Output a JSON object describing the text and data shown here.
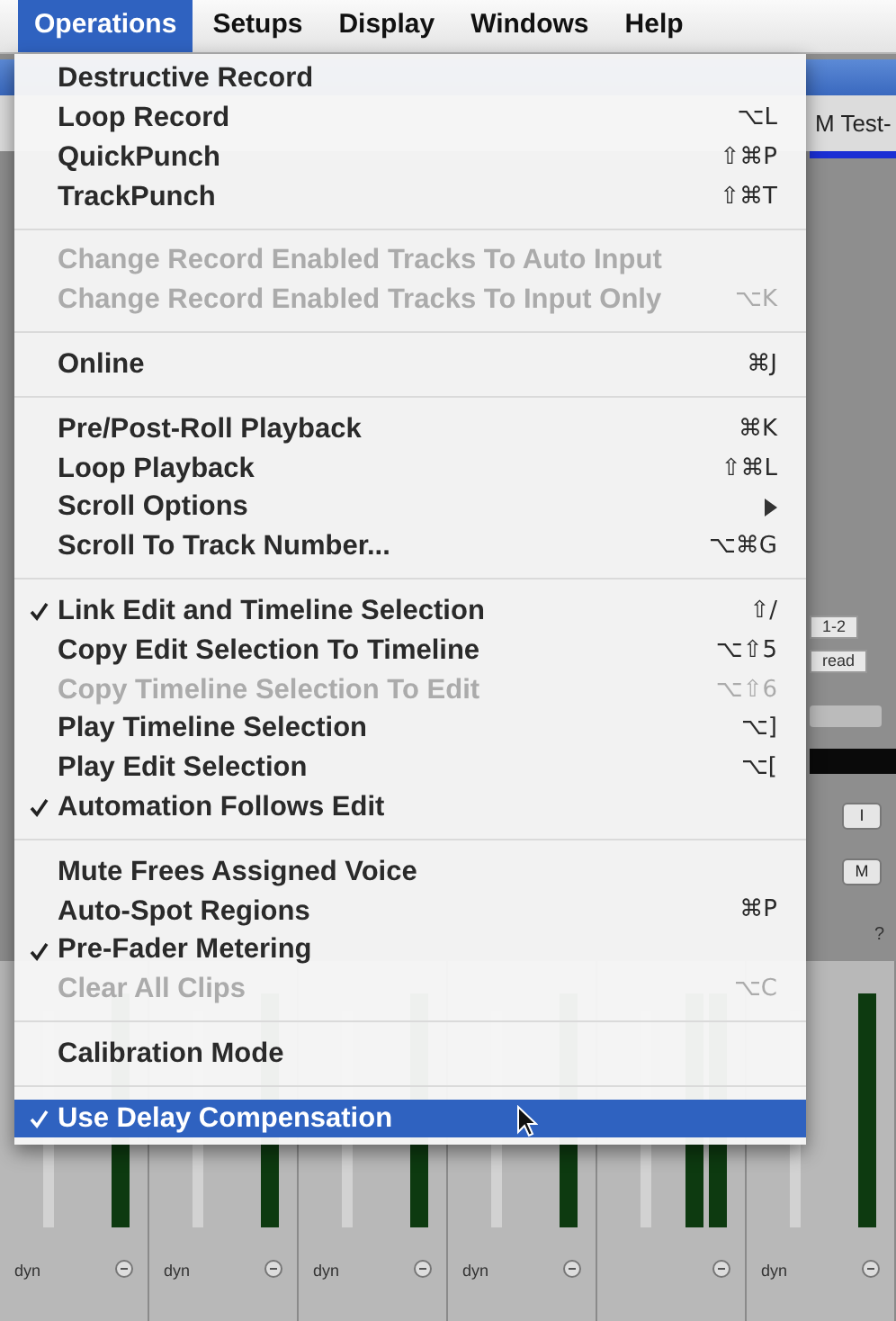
{
  "menu_bar": [
    {
      "label": "Operations",
      "selected": true
    },
    {
      "label": "Setups",
      "selected": false
    },
    {
      "label": "Display",
      "selected": false
    },
    {
      "label": "Windows",
      "selected": false
    },
    {
      "label": "Help",
      "selected": false
    }
  ],
  "menu": {
    "groups": [
      {
        "items": [
          {
            "label": "Destructive Record",
            "checked": false,
            "disabled": false,
            "highlighted": false,
            "submenu": false
          },
          {
            "label": "Loop Record",
            "shortcut": "⌥L",
            "checked": false,
            "disabled": false,
            "highlighted": false,
            "submenu": false
          },
          {
            "label": "QuickPunch",
            "shortcut": "⇧⌘P",
            "checked": false,
            "disabled": false,
            "highlighted": false,
            "submenu": false
          },
          {
            "label": "TrackPunch",
            "shortcut": "⇧⌘T",
            "checked": false,
            "disabled": false,
            "highlighted": false,
            "submenu": false
          }
        ]
      },
      {
        "items": [
          {
            "label": "Change Record Enabled Tracks To Auto Input",
            "checked": false,
            "disabled": true,
            "highlighted": false,
            "submenu": false
          },
          {
            "label": "Change Record Enabled Tracks To Input Only",
            "shortcut": "⌥K",
            "checked": false,
            "disabled": true,
            "highlighted": false,
            "submenu": false
          }
        ]
      },
      {
        "items": [
          {
            "label": "Online",
            "shortcut": "⌘J",
            "checked": false,
            "disabled": false,
            "highlighted": false,
            "submenu": false
          }
        ]
      },
      {
        "items": [
          {
            "label": "Pre/Post-Roll Playback",
            "shortcut": "⌘K",
            "checked": false,
            "disabled": false,
            "highlighted": false,
            "submenu": false
          },
          {
            "label": "Loop Playback",
            "shortcut": "⇧⌘L",
            "checked": false,
            "disabled": false,
            "highlighted": false,
            "submenu": false
          },
          {
            "label": "Scroll Options",
            "checked": false,
            "disabled": false,
            "highlighted": false,
            "submenu": true
          },
          {
            "label": "Scroll To Track Number...",
            "shortcut": "⌥⌘G",
            "checked": false,
            "disabled": false,
            "highlighted": false,
            "submenu": false
          }
        ]
      },
      {
        "items": [
          {
            "label": "Link Edit and Timeline Selection",
            "shortcut": "⇧/",
            "checked": true,
            "disabled": false,
            "highlighted": false,
            "submenu": false
          },
          {
            "label": "Copy Edit Selection To Timeline",
            "shortcut": "⌥⇧5",
            "checked": false,
            "disabled": false,
            "highlighted": false,
            "submenu": false
          },
          {
            "label": "Copy Timeline Selection To Edit",
            "shortcut": "⌥⇧6",
            "checked": false,
            "disabled": true,
            "highlighted": false,
            "submenu": false
          },
          {
            "label": "Play Timeline Selection",
            "shortcut": "⌥]",
            "checked": false,
            "disabled": false,
            "highlighted": false,
            "submenu": false
          },
          {
            "label": "Play Edit Selection",
            "shortcut": "⌥[",
            "checked": false,
            "disabled": false,
            "highlighted": false,
            "submenu": false
          },
          {
            "label": "Automation Follows Edit",
            "checked": true,
            "disabled": false,
            "highlighted": false,
            "submenu": false
          }
        ]
      },
      {
        "items": [
          {
            "label": "Mute Frees Assigned Voice",
            "checked": false,
            "disabled": false,
            "highlighted": false,
            "submenu": false
          },
          {
            "label": "Auto-Spot Regions",
            "shortcut": "⌘P",
            "checked": false,
            "disabled": false,
            "highlighted": false,
            "submenu": false
          },
          {
            "label": "Pre-Fader Metering",
            "checked": true,
            "disabled": false,
            "highlighted": false,
            "submenu": false
          },
          {
            "label": "Clear All Clips",
            "shortcut": "⌥C",
            "checked": false,
            "disabled": true,
            "highlighted": false,
            "submenu": false
          }
        ]
      },
      {
        "items": [
          {
            "label": "Calibration Mode",
            "checked": false,
            "disabled": false,
            "highlighted": false,
            "submenu": false
          }
        ]
      },
      {
        "items": [
          {
            "label": "Use Delay Compensation",
            "checked": true,
            "disabled": false,
            "highlighted": true,
            "submenu": false
          }
        ]
      }
    ]
  },
  "mixer_window": {
    "title": "M Test-",
    "side_controls": [
      {
        "kind": "tag",
        "text": "1-2"
      },
      {
        "kind": "tag",
        "text": "read"
      },
      {
        "kind": "slider"
      },
      {
        "kind": "display"
      },
      {
        "kind": "button",
        "text": "I"
      },
      {
        "kind": "button",
        "text": "M"
      },
      {
        "kind": "label",
        "text": "?"
      }
    ],
    "strips": [
      {
        "kind": "mono",
        "label": "dyn"
      },
      {
        "kind": "mono",
        "label": "dyn"
      },
      {
        "kind": "mono",
        "label": "dyn"
      },
      {
        "kind": "mono",
        "label": "dyn"
      },
      {
        "kind": "stereo"
      },
      {
        "kind": "mono",
        "label": "dyn"
      }
    ]
  }
}
